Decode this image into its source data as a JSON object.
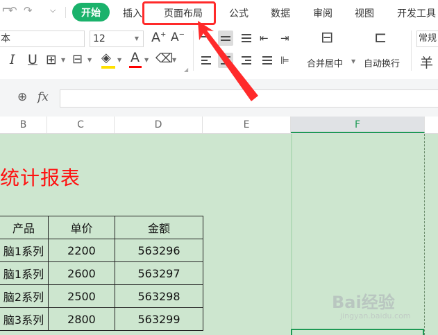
{
  "menu": {
    "tabs": [
      "开始",
      "插入",
      "页面布局",
      "公式",
      "数据",
      "审阅",
      "视图",
      "开发工具"
    ],
    "highlighted_tab": "页面布局",
    "active_tab_color": "#1ab26b",
    "highlight_color": "#ff2a2a"
  },
  "ribbon": {
    "font_name": "本",
    "font_size": "12",
    "merge_center_label": "合并居中",
    "wrap_text_label": "自动换行",
    "number_format": "常规",
    "currency_symbol": "羊",
    "font_color": "#ff0000",
    "fill_color": "#ffe000",
    "increase_font_glyph": "A",
    "decrease_font_glyph": "A",
    "italic_glyph": "I",
    "underline_glyph": "U",
    "fontcolor_glyph": "A"
  },
  "formula_bar": {
    "fx_label": "fx",
    "value": ""
  },
  "columns": [
    "B",
    "C",
    "D",
    "E",
    "F"
  ],
  "selected_column": "F",
  "sheet": {
    "title": "统计报表",
    "title_color": "#ff1010",
    "header": [
      "产品",
      "单价",
      "金额"
    ],
    "rows": [
      [
        "脑1系列",
        "2200",
        "563296"
      ],
      [
        "脑1系列",
        "2600",
        "563297"
      ],
      [
        "脑2系列",
        "2500",
        "563298"
      ],
      [
        "脑3系列",
        "2800",
        "563299"
      ]
    ],
    "background": "#cde6cf"
  },
  "watermark": {
    "main": "Bai经验",
    "sub": "jingyan.baidu.com"
  }
}
